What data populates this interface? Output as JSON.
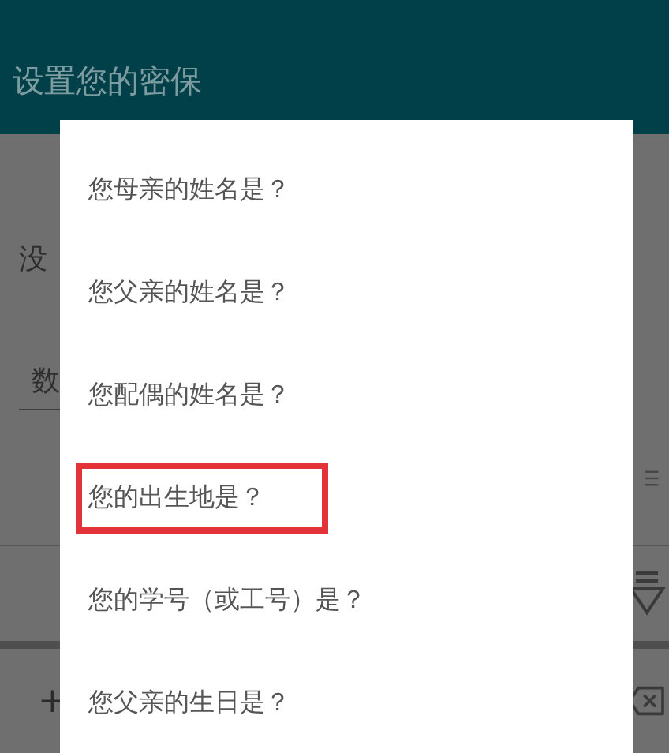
{
  "app_bar": {
    "title": "设置您的密保"
  },
  "background": {
    "label_text": "没",
    "field_text": "数",
    "add_symbol": "+"
  },
  "dialog": {
    "options": [
      {
        "label": "您母亲的姓名是？",
        "selected": false
      },
      {
        "label": "您父亲的姓名是？",
        "selected": false
      },
      {
        "label": "您配偶的姓名是？",
        "selected": false
      },
      {
        "label": "您的出生地是？",
        "selected": true
      },
      {
        "label": "您的学号（或工号）是？",
        "selected": false
      },
      {
        "label": "您父亲的生日是？",
        "selected": false
      }
    ]
  }
}
